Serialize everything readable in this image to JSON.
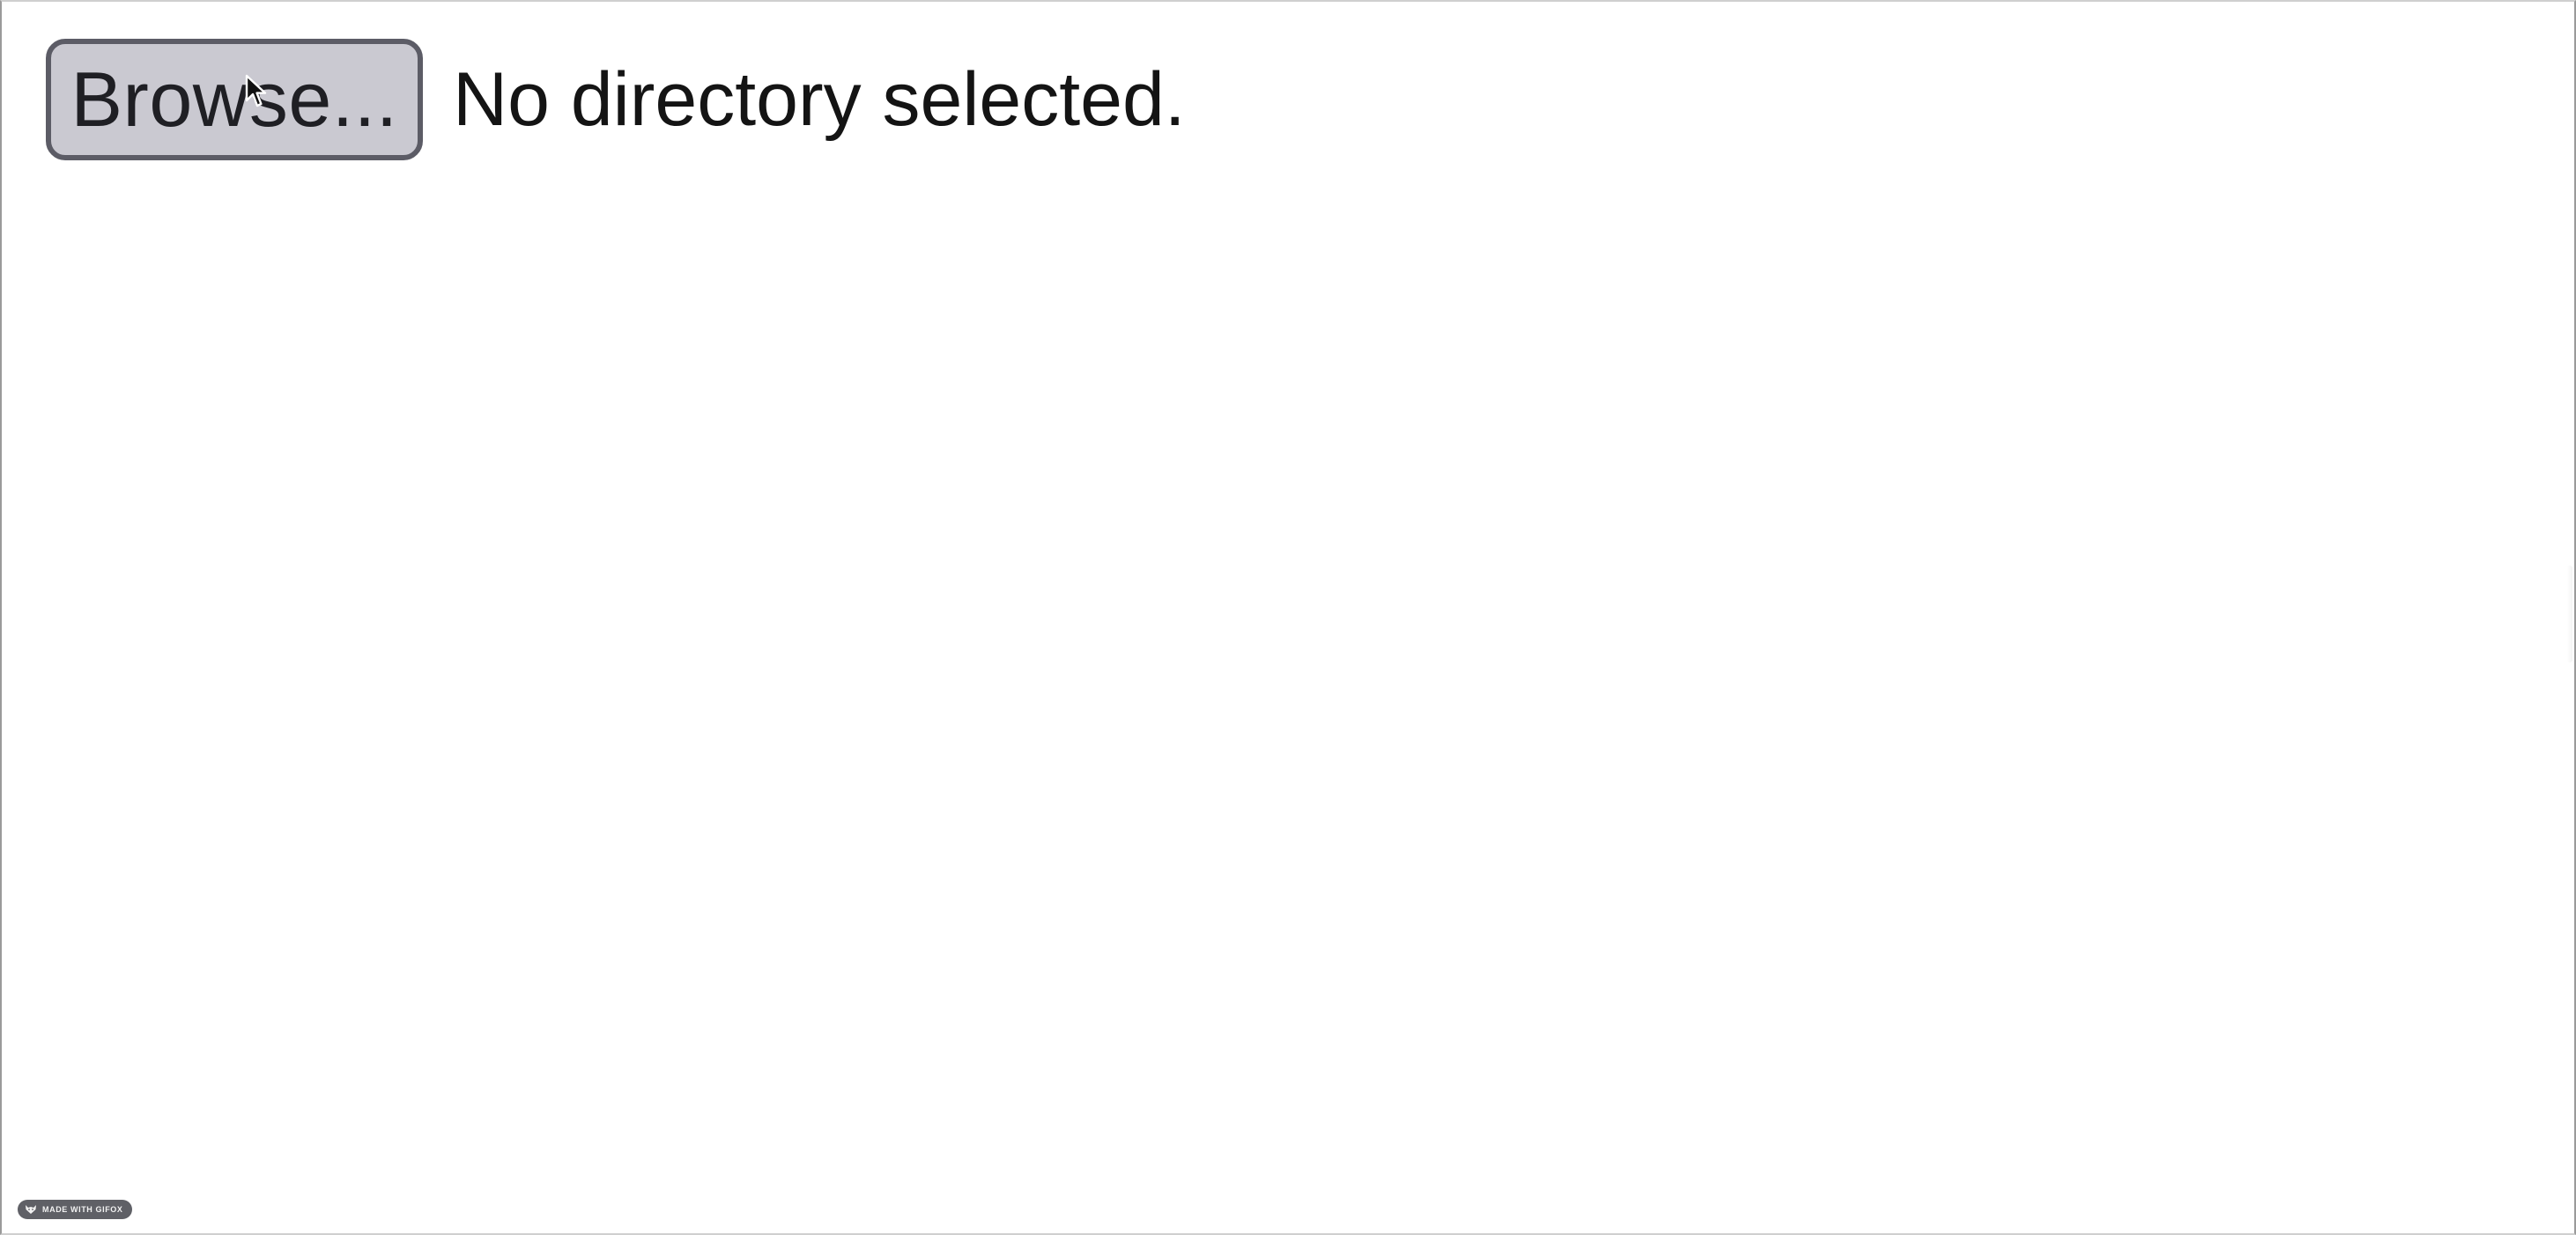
{
  "picker": {
    "browse_label": "Browse...",
    "status": "No directory selected."
  },
  "badge": {
    "label": "MADE WITH GIFOX",
    "icon": "fox-icon"
  },
  "colors": {
    "button_bg": "#cac9d1",
    "button_border": "#5c5c66",
    "text": "#141414",
    "badge_bg": "#5f6066"
  }
}
